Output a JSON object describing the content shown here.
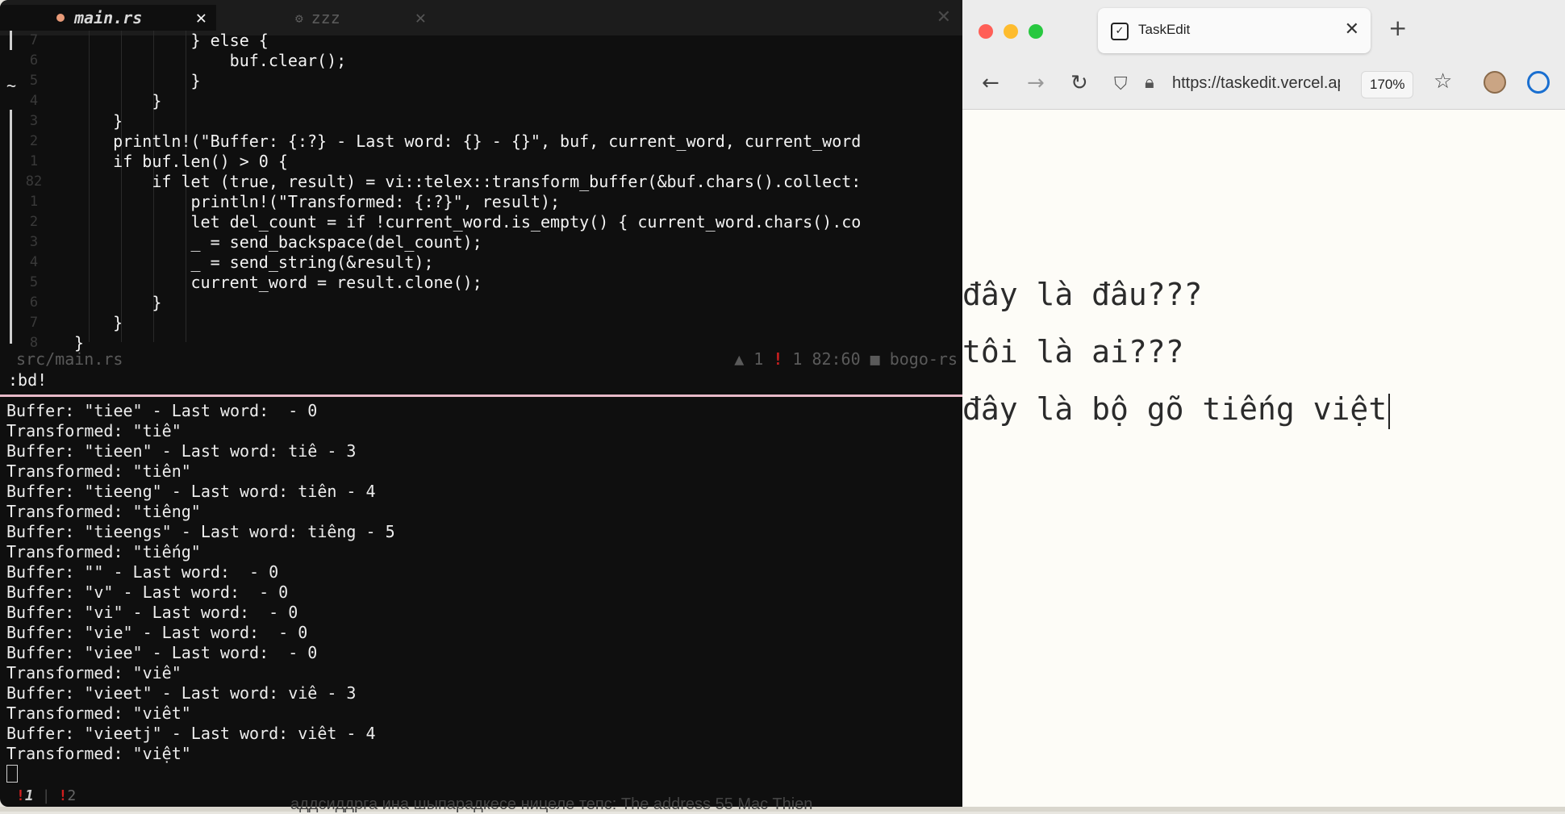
{
  "terminal": {
    "tabs": [
      {
        "label": "main.rs",
        "active": true
      },
      {
        "label": "zzz",
        "active": false
      }
    ],
    "editor_lines": [
      {
        "num": "7",
        "code": "            } else {"
      },
      {
        "num": "6",
        "code": "                buf.clear();"
      },
      {
        "num": "5",
        "code": "            }"
      },
      {
        "num": "4",
        "code": "        }"
      },
      {
        "num": "3",
        "code": "    }"
      },
      {
        "num": "2",
        "code": "    println!(\"Buffer: {:?} - Last word: {} - {}\", buf, current_word, current_word"
      },
      {
        "num": "1",
        "code": "    if buf.len() > 0 {"
      },
      {
        "num": "82",
        "code": "        if let (true, result) = vi::telex::transform_buffer(&buf.chars().collect:"
      },
      {
        "num": "1",
        "code": "            println!(\"Transformed: {:?}\", result);"
      },
      {
        "num": "2",
        "code": "            let del_count = if !current_word.is_empty() { current_word.chars().co"
      },
      {
        "num": "3",
        "code": "            _ = send_backspace(del_count);"
      },
      {
        "num": "4",
        "code": "            _ = send_string(&result);"
      },
      {
        "num": "5",
        "code": "            current_word = result.clone();"
      },
      {
        "num": "6",
        "code": "        }"
      },
      {
        "num": "7",
        "code": "    }"
      },
      {
        "num": "8",
        "code": "}"
      }
    ],
    "tilde": "~",
    "status": {
      "file": "src/main.rs",
      "warn_icon": "▲",
      "warnings": "1",
      "err_icon": "!",
      "errors": "1",
      "position": "82:60",
      "project_icon": "■",
      "project": "bogo-rs"
    },
    "command": ":bd!",
    "output_lines": [
      "Buffer: \"tiee\" - Last word:  - 0",
      "Transformed: \"tiê\"",
      "Buffer: \"tieen\" - Last word: tiê - 3",
      "Transformed: \"tiên\"",
      "Buffer: \"tieeng\" - Last word: tiên - 4",
      "Transformed: \"tiêng\"",
      "Buffer: \"tieengs\" - Last word: tiêng - 5",
      "Transformed: \"tiếng\"",
      "Buffer: \"\" - Last word:  - 0",
      "Buffer: \"v\" - Last word:  - 0",
      "Buffer: \"vi\" - Last word:  - 0",
      "Buffer: \"vie\" - Last word:  - 0",
      "Buffer: \"viee\" - Last word:  - 0",
      "Transformed: \"viê\"",
      "Buffer: \"vieet\" - Last word: viê - 3",
      "Transformed: \"viêt\"",
      "Buffer: \"vieetj\" - Last word: viêt - 4",
      "Transformed: \"việt\""
    ],
    "panes": [
      {
        "marker": "!",
        "num": "1"
      },
      {
        "separator": "|"
      },
      {
        "marker": "!",
        "num": "2"
      }
    ]
  },
  "browser": {
    "tab_title": "TaskEdit",
    "url": "https://taskedit.vercel.app",
    "zoom": "170%",
    "doc_lines": [
      "đây là đâu???",
      "tôi là ai???",
      "đây là bộ gõ tiếng việt"
    ]
  },
  "background": {
    "text": "аддсиддрга ина шыпарадкесе ницеле тепс: The address 55 Mac Thien"
  },
  "colors": {
    "terminal_bg": "#0f0f0f",
    "split_line": "#e7b9c7",
    "error_red": "#c82020",
    "page_bg": "#fdfcf7"
  }
}
